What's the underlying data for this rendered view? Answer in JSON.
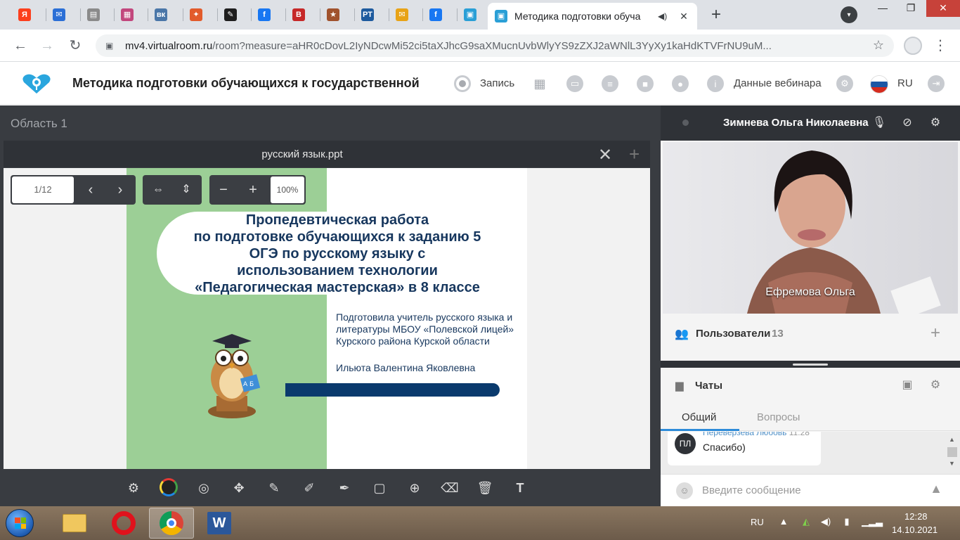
{
  "browser": {
    "active_tab_title": "Методика подготовки обуча",
    "url_host": "mv4.virtualroom.ru",
    "url_rest": "/room?measure=aHR0cDovL2IyNDcwMi52ci5taXJhcG9saXMucnUvbWlyYS9zZXJ2aWNlL3YyXy1kaHdKTVFrNU9uM...",
    "icons": {
      "back": "←",
      "forward": "→",
      "reload": "↻",
      "lock": "🔒",
      "star": "☆",
      "menu": "⋮",
      "close": "✕",
      "new_tab": "+"
    },
    "mini_tabs": [
      {
        "icon": "yandex-icon",
        "glyph": "Я",
        "color": "#fc3f1d"
      },
      {
        "icon": "mail-icon",
        "glyph": "✉",
        "color": "#2b6fd6"
      },
      {
        "icon": "document-icon",
        "glyph": "▤",
        "color": "#8a8a8a"
      },
      {
        "icon": "photo-icon",
        "glyph": "▦",
        "color": "#c2477d"
      },
      {
        "icon": "vk-icon",
        "glyph": "вк",
        "color": "#4a76a8"
      },
      {
        "icon": "games-icon",
        "glyph": "✦",
        "color": "#e25b2b"
      },
      {
        "icon": "app-icon",
        "glyph": "✎",
        "color": "#1e1e1e"
      },
      {
        "icon": "facebook-icon",
        "glyph": "f",
        "color": "#1877f2"
      },
      {
        "icon": "book-icon",
        "glyph": "B",
        "color": "#c62828"
      },
      {
        "icon": "star-badge-icon",
        "glyph": "★",
        "color": "#a0522d"
      },
      {
        "icon": "rt-icon",
        "glyph": "РТ",
        "color": "#1d5a9e"
      },
      {
        "icon": "envelope-icon",
        "glyph": "✉",
        "color": "#e8a317"
      },
      {
        "icon": "facebook-icon",
        "glyph": "f",
        "color": "#1877f2"
      },
      {
        "icon": "webinar-icon",
        "glyph": "▣",
        "color": "#2a9fd6"
      }
    ]
  },
  "header": {
    "title": "Методика подготовки обучающихся к государственной и...",
    "record_label": "Запись",
    "webinar_data_label": "Данные вебинара",
    "lang": "RU",
    "icon_glyphs": {
      "record": "◉",
      "grid": "▦",
      "screen": "▭",
      "notes": "≡",
      "folder": "■",
      "user_add": "●",
      "info": "i",
      "settings": "⚙",
      "exit": "⇥"
    }
  },
  "workspace": {
    "area_label": "Область 1",
    "presentation_title": "русский язык.ppt",
    "page_indicator": "1/12",
    "zoom": "100%",
    "controls": {
      "prev": "‹",
      "next": "›",
      "fit_width": "⇔",
      "fit_height": "⇕",
      "zoom_out": "−",
      "zoom_in": "+",
      "close": "✕",
      "add": "+"
    },
    "slide": {
      "title": "Пропедевтическая работа по подготовке обучающихся к заданию 5 ОГЭ по русскому языку с использованием технологии «Педагогическая мастерская» в 8 классе",
      "title_lines": [
        "Пропедевтическая работа",
        "по подготовке обучающихся к заданию 5",
        "ОГЭ по русскому языку с",
        "использованием технологии",
        "«Педагогическая мастерская» в 8 классе"
      ],
      "author_info": "Подготовила учитель русского языка и литературы МБОУ «Полевской лицей» Курского района Курской области",
      "author_name": "Ильюта Валентина Яковлевна",
      "owl_book_text": "А Б"
    },
    "tools": [
      {
        "name": "settings-tool",
        "glyph": "⚙"
      },
      {
        "name": "color-tool",
        "glyph": ""
      },
      {
        "name": "pointer-tool",
        "glyph": "◎"
      },
      {
        "name": "move-tool",
        "glyph": "✥"
      },
      {
        "name": "brush-tool",
        "glyph": "✎"
      },
      {
        "name": "pencil-tool",
        "glyph": "✐"
      },
      {
        "name": "marker-tool",
        "glyph": "✒"
      },
      {
        "name": "shape-tool",
        "glyph": "▢"
      },
      {
        "name": "target-tool",
        "glyph": "⊕"
      },
      {
        "name": "eraser-tool",
        "glyph": "⌫"
      },
      {
        "name": "delete-tool",
        "glyph": "🗑"
      },
      {
        "name": "text-tool",
        "glyph": "T"
      }
    ]
  },
  "speaker": {
    "name": "Зимнева Ольга Николаевна",
    "video_label": "Ефремова Ольга",
    "icons": {
      "mic_off": "🎙",
      "camera_off": "⊘",
      "settings": "⚙"
    }
  },
  "users": {
    "label": "Пользователи",
    "count": "13",
    "add": "+"
  },
  "chats": {
    "label": "Чаты",
    "tabs": [
      "Общий",
      "Вопросы"
    ],
    "messages": [
      {
        "initials": "ПЛ",
        "author": "Переверзева Любовь",
        "time": "11:28",
        "text": "Спасибо)"
      }
    ],
    "input_placeholder": "Введите сообщение",
    "icons": {
      "chat": "▪",
      "attach": "▣",
      "settings": "⚙",
      "emoji": "☺",
      "send": "▲"
    }
  },
  "taskbar": {
    "lang": "RU",
    "time": "12:28",
    "date": "14.10.2021",
    "apps": [
      {
        "name": "explorer-icon",
        "glyph": "📁"
      },
      {
        "name": "opera-icon",
        "glyph": "O"
      },
      {
        "name": "chrome-icon",
        "glyph": ""
      },
      {
        "name": "word-icon",
        "glyph": "W"
      }
    ]
  }
}
